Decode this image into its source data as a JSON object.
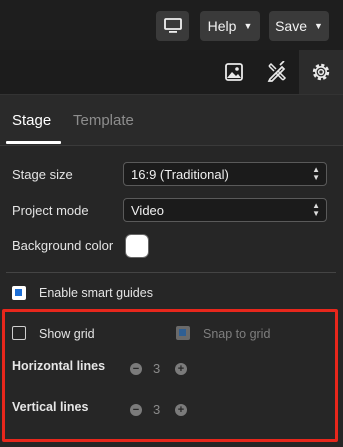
{
  "toolbar": {
    "display_icon": "monitor-icon",
    "help_label": "Help",
    "save_label": "Save"
  },
  "panel_icons": [
    "image-icon",
    "design-tools-icon",
    "gear-icon"
  ],
  "tabs": [
    {
      "label": "Stage",
      "active": true
    },
    {
      "label": "Template",
      "active": false
    }
  ],
  "settings": {
    "stage_size": {
      "label": "Stage size",
      "value": "16:9 (Traditional)"
    },
    "project_mode": {
      "label": "Project mode",
      "value": "Video"
    },
    "background_color": {
      "label": "Background color",
      "color": "#ffffff"
    },
    "smart_guides": {
      "label": "Enable smart guides",
      "checked": true
    }
  },
  "grid": {
    "show_grid": {
      "label": "Show grid",
      "checked": false
    },
    "snap_to_grid": {
      "label": "Snap to grid",
      "checked": true,
      "disabled": true
    },
    "horizontal_lines": {
      "label": "Horizontal lines",
      "value": "3"
    },
    "vertical_lines": {
      "label": "Vertical lines",
      "value": "3"
    }
  },
  "colors": {
    "accent": "#1d6fd6",
    "highlight_box": "#e8271c",
    "background": "#262626"
  }
}
